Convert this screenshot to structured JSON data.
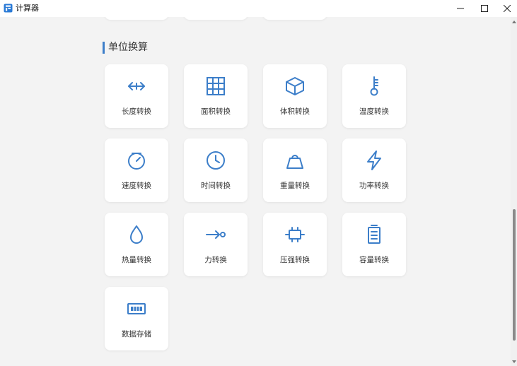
{
  "window": {
    "title": "计算器",
    "icon": "calculator-app-icon",
    "controls": [
      "minimize-icon",
      "maximize-icon",
      "close-icon"
    ]
  },
  "accent_color": "#3c7ec9",
  "section": {
    "title": "单位换算",
    "items": [
      {
        "label": "长度转换",
        "icon": "arrows-horizontal-icon"
      },
      {
        "label": "面积转换",
        "icon": "grid-icon"
      },
      {
        "label": "体积转换",
        "icon": "cube-icon"
      },
      {
        "label": "温度转换",
        "icon": "thermometer-icon"
      },
      {
        "label": "速度转换",
        "icon": "speedometer-icon"
      },
      {
        "label": "时间转换",
        "icon": "clock-icon"
      },
      {
        "label": "重量转换",
        "icon": "weight-icon"
      },
      {
        "label": "功率转换",
        "icon": "lightning-icon"
      },
      {
        "label": "热量转换",
        "icon": "droplet-icon"
      },
      {
        "label": "力转换",
        "icon": "force-arrow-icon"
      },
      {
        "label": "压强转换",
        "icon": "pressure-icon"
      },
      {
        "label": "容量转换",
        "icon": "container-icon"
      },
      {
        "label": "数据存储",
        "icon": "memory-chip-icon"
      }
    ]
  }
}
